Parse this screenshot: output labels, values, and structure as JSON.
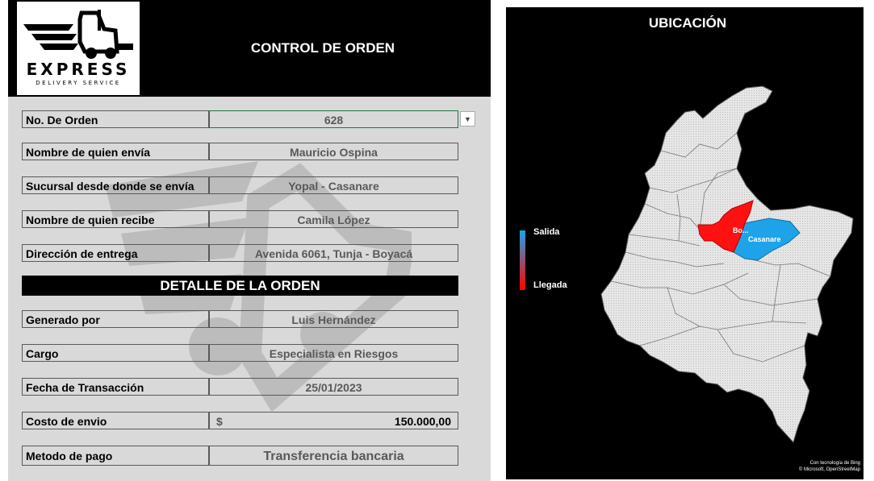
{
  "logo": {
    "main": "EXPRESS",
    "sub": "DELIVERY SERVICE"
  },
  "header": {
    "title": "CONTROL DE ORDEN"
  },
  "order": {
    "order_no": {
      "label": "No. De Orden",
      "value": "628"
    },
    "sender": {
      "label": "Nombre de quien envía",
      "value": "Mauricio Ospina"
    },
    "branch": {
      "label": "Sucursal desde donde se envía",
      "value": "Yopal - Casanare"
    },
    "receiver": {
      "label": "Nombre de quien recibe",
      "value": "Camila López"
    },
    "address": {
      "label": "Dirección de entrega",
      "value": "Avenida 6061, Tunja - Boyacá"
    }
  },
  "details": {
    "section_title": "DETALLE DE LA ORDEN",
    "generated_by": {
      "label": "Generado por",
      "value": "Luis Hernández"
    },
    "role": {
      "label": "Cargo",
      "value": "Especialista en Riesgos"
    },
    "date": {
      "label": "Fecha de Transacción",
      "value": "25/01/2023"
    },
    "cost": {
      "label": "Costo de envio",
      "currency": "$",
      "value": "150.000,00"
    },
    "payment": {
      "label": "Metodo de pago",
      "value": "Transferencia bancaria"
    }
  },
  "map": {
    "title": "UBICACIÓN",
    "legend": {
      "start_label": "Salida",
      "end_label": "Llegada",
      "start_color": "#1fa3e8",
      "end_color": "#ff0000"
    },
    "regions": {
      "origin": "Casanare",
      "destination": "Bo..."
    },
    "credit_line1": "Con tecnología de Bing",
    "credit_line2": "© Microsoft, OpenStreetMap"
  },
  "icons": {
    "dropdown": "chevron-down-icon"
  }
}
